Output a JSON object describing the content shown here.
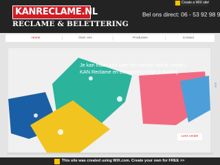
{
  "wix_badge": {
    "label": "Create a WIX site!"
  },
  "logo": {
    "name": "KANRECLAME.NL",
    "tagline": "RECLAME & BELETTERING"
  },
  "header": {
    "phone": "Bel ons direct: 06 - 53 92 98 90"
  },
  "nav": {
    "items": [
      {
        "label": "Home",
        "active": true
      },
      {
        "label": "Over ons"
      },
      {
        "label": "Producten"
      },
      {
        "label": "Contact"
      }
    ]
  },
  "hero": {
    "line1": "Je kan maar een keer een eerste indruk maken.",
    "line2": "KAN Reclame en Belettering helpt je daarbij.",
    "button_label": "Lees verder",
    "card_colors": [
      "#1a5fa6",
      "#2bb39c",
      "#f2c420",
      "#f26a82",
      "#4d9fd9"
    ]
  },
  "footer_banner": {
    "label": "This site was created using WIX.com. Create your own for FREE >>"
  }
}
